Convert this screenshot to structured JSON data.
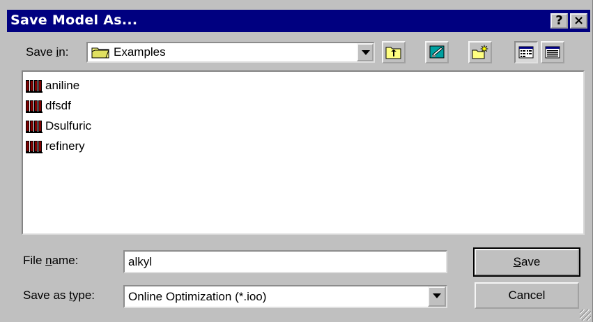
{
  "window": {
    "title": "Save Model As...",
    "help_label": "?",
    "close_label": "×"
  },
  "save_in": {
    "label_pre": "Save ",
    "label_underlined": "i",
    "label_post": "n:",
    "value": "Examples"
  },
  "toolbar": [
    {
      "name": "up-one-level-button",
      "icon": "folder-up-icon"
    },
    {
      "name": "go-to-desktop-button",
      "icon": "desktop-icon"
    },
    {
      "name": "create-new-folder-button",
      "icon": "new-folder-icon"
    },
    {
      "name": "list-view-button",
      "icon": "list-view-icon",
      "pressed": true
    },
    {
      "name": "details-view-button",
      "icon": "details-view-icon"
    }
  ],
  "files": [
    {
      "name": "aniline",
      "icon": "model-file-icon"
    },
    {
      "name": "dfsdf",
      "icon": "model-file-icon"
    },
    {
      "name": "Dsulfuric",
      "icon": "model-file-icon"
    },
    {
      "name": "refinery",
      "icon": "model-file-icon"
    }
  ],
  "file_name": {
    "label_pre": "File ",
    "label_underlined": "n",
    "label_post": "ame:",
    "value": "alkyl"
  },
  "save_as_type": {
    "label_pre": "Save as ",
    "label_underlined": "t",
    "label_post": "ype:",
    "value": "Online Optimization (*.ioo)"
  },
  "buttons": {
    "save_underlined": "S",
    "save_rest": "ave",
    "cancel": "Cancel"
  }
}
